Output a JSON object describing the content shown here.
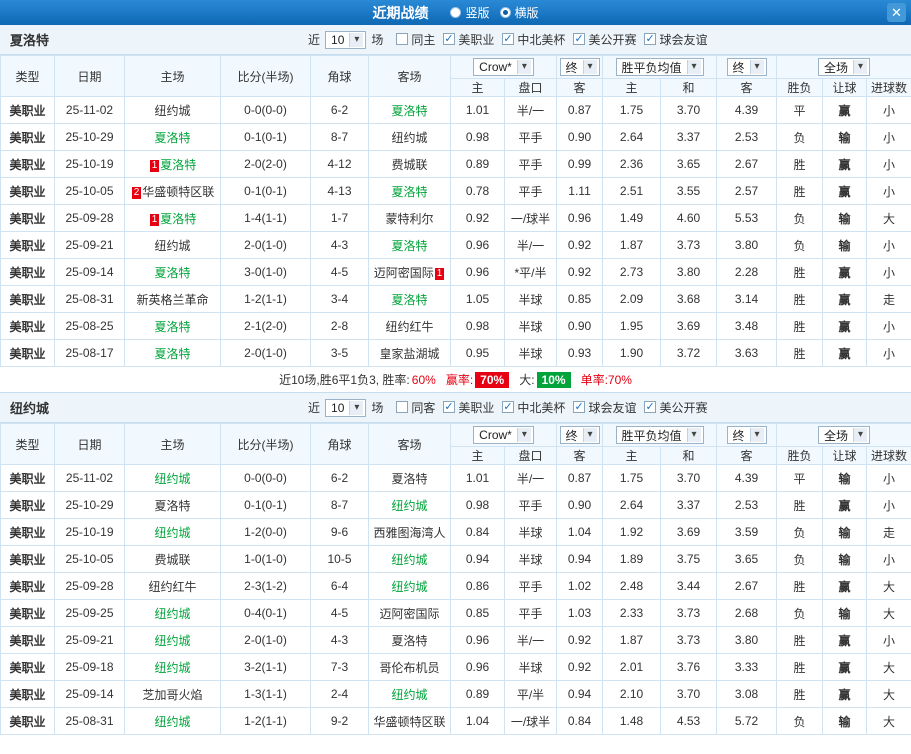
{
  "topbar": {
    "title": "近期战绩",
    "layout_options": [
      {
        "label": "竖版",
        "selected": false
      },
      {
        "label": "横版",
        "selected": true
      }
    ]
  },
  "ui": {
    "near_label": "近",
    "games_label": "场",
    "book_select": "Crow*",
    "final_select": "终",
    "avg_select": "胜平负均值",
    "scope_select": "全场",
    "columns": {
      "type": "类型",
      "date": "日期",
      "home": "主场",
      "score": "比分(半场)",
      "corners": "角球",
      "away": "客场",
      "odds_home": "主",
      "odds_line": "盘口",
      "odds_away": "客",
      "avg_home": "主",
      "avg_draw": "和",
      "avg_away": "客",
      "result": "胜负",
      "handicap": "让球",
      "goals": "进球数"
    }
  },
  "colors": {
    "accent_red": "#e60012",
    "accent_green": "#00a43a",
    "accent_blue": "#2b5ea7",
    "type_bg": "#9e0050",
    "topbar_bg": "#1478c8"
  },
  "sections": [
    {
      "team": "夏洛特",
      "recent_count": "10",
      "checkboxes": [
        {
          "label": "同主",
          "checked": false
        },
        {
          "label": "美职业",
          "checked": true
        },
        {
          "label": "中北美杯",
          "checked": true
        },
        {
          "label": "美公开赛",
          "checked": true
        },
        {
          "label": "球会友谊",
          "checked": true
        }
      ],
      "rows": [
        {
          "type": "美职业",
          "date": "25-11-02",
          "home": "纽约城",
          "home_badge": "",
          "home_focal": false,
          "score": "0-0(0-0)",
          "corners": "6-2",
          "away": "夏洛特",
          "away_badge": "",
          "away_focal": true,
          "odds": [
            "1.01",
            "半/一",
            "0.87"
          ],
          "avg": [
            "1.75",
            "3.70",
            "4.39"
          ],
          "result": "平",
          "handicap": "赢",
          "goals": "小"
        },
        {
          "type": "美职业",
          "date": "25-10-29",
          "home": "夏洛特",
          "home_badge": "",
          "home_focal": true,
          "score": "0-1(0-1)",
          "corners": "8-7",
          "away": "纽约城",
          "away_badge": "",
          "away_focal": false,
          "odds": [
            "0.98",
            "平手",
            "0.90"
          ],
          "avg": [
            "2.64",
            "3.37",
            "2.53"
          ],
          "result": "负",
          "handicap": "输",
          "goals": "小"
        },
        {
          "type": "美职业",
          "date": "25-10-19",
          "home": "夏洛特",
          "home_badge": "1",
          "home_focal": true,
          "score": "2-0(2-0)",
          "corners": "4-12",
          "away": "费城联",
          "away_badge": "",
          "away_focal": false,
          "odds": [
            "0.89",
            "平手",
            "0.99"
          ],
          "avg": [
            "2.36",
            "3.65",
            "2.67"
          ],
          "result": "胜",
          "handicap": "赢",
          "goals": "小"
        },
        {
          "type": "美职业",
          "date": "25-10-05",
          "home": "华盛顿特区联",
          "home_badge": "2",
          "home_focal": false,
          "score": "0-1(0-1)",
          "corners": "4-13",
          "away": "夏洛特",
          "away_badge": "",
          "away_focal": true,
          "odds": [
            "0.78",
            "平手",
            "1.11"
          ],
          "avg": [
            "2.51",
            "3.55",
            "2.57"
          ],
          "result": "胜",
          "handicap": "赢",
          "goals": "小"
        },
        {
          "type": "美职业",
          "date": "25-09-28",
          "home": "夏洛特",
          "home_badge": "1",
          "home_focal": true,
          "score": "1-4(1-1)",
          "corners": "1-7",
          "away": "蒙特利尔",
          "away_badge": "",
          "away_focal": false,
          "odds": [
            "0.92",
            "一/球半",
            "0.96"
          ],
          "avg": [
            "1.49",
            "4.60",
            "5.53"
          ],
          "result": "负",
          "handicap": "输",
          "goals": "大"
        },
        {
          "type": "美职业",
          "date": "25-09-21",
          "home": "纽约城",
          "home_badge": "",
          "home_focal": false,
          "score": "2-0(1-0)",
          "corners": "4-3",
          "away": "夏洛特",
          "away_badge": "",
          "away_focal": true,
          "odds": [
            "0.96",
            "半/一",
            "0.92"
          ],
          "avg": [
            "1.87",
            "3.73",
            "3.80"
          ],
          "result": "负",
          "handicap": "输",
          "goals": "小"
        },
        {
          "type": "美职业",
          "date": "25-09-14",
          "home": "夏洛特",
          "home_badge": "",
          "home_focal": true,
          "score": "3-0(1-0)",
          "corners": "4-5",
          "away": "迈阿密国际",
          "away_badge": "1",
          "away_focal": false,
          "odds": [
            "0.96",
            "*平/半",
            "0.92"
          ],
          "avg": [
            "2.73",
            "3.80",
            "2.28"
          ],
          "result": "胜",
          "handicap": "赢",
          "goals": "小"
        },
        {
          "type": "美职业",
          "date": "25-08-31",
          "home": "新英格兰革命",
          "home_badge": "",
          "home_focal": false,
          "score": "1-2(1-1)",
          "corners": "3-4",
          "away": "夏洛特",
          "away_badge": "",
          "away_focal": true,
          "odds": [
            "1.05",
            "半球",
            "0.85"
          ],
          "avg": [
            "2.09",
            "3.68",
            "3.14"
          ],
          "result": "胜",
          "handicap": "赢",
          "goals": "走"
        },
        {
          "type": "美职业",
          "date": "25-08-25",
          "home": "夏洛特",
          "home_badge": "",
          "home_focal": true,
          "score": "2-1(2-0)",
          "corners": "2-8",
          "away": "纽约红牛",
          "away_badge": "",
          "away_focal": false,
          "odds": [
            "0.98",
            "半球",
            "0.90"
          ],
          "avg": [
            "1.95",
            "3.69",
            "3.48"
          ],
          "result": "胜",
          "handicap": "赢",
          "goals": "小"
        },
        {
          "type": "美职业",
          "date": "25-08-17",
          "home": "夏洛特",
          "home_badge": "",
          "home_focal": true,
          "score": "2-0(1-0)",
          "corners": "3-5",
          "away": "皇家盐湖城",
          "away_badge": "",
          "away_focal": false,
          "odds": [
            "0.95",
            "半球",
            "0.93"
          ],
          "avg": [
            "1.90",
            "3.72",
            "3.63"
          ],
          "result": "胜",
          "handicap": "赢",
          "goals": "小"
        }
      ],
      "summary": {
        "prefix": "近10场,胜6平1负3, 胜率:",
        "win_pct": "60%",
        "handicap_label": "赢率:",
        "handicap_pct": "70%",
        "big_label": "大:",
        "big_pct": "10%",
        "single_label": "单率:70%"
      }
    },
    {
      "team": "纽约城",
      "recent_count": "10",
      "checkboxes": [
        {
          "label": "同客",
          "checked": false
        },
        {
          "label": "美职业",
          "checked": true
        },
        {
          "label": "中北美杯",
          "checked": true
        },
        {
          "label": "球会友谊",
          "checked": true
        },
        {
          "label": "美公开赛",
          "checked": true
        }
      ],
      "rows": [
        {
          "type": "美职业",
          "date": "25-11-02",
          "home": "纽约城",
          "home_badge": "",
          "home_focal": true,
          "score": "0-0(0-0)",
          "corners": "6-2",
          "away": "夏洛特",
          "away_badge": "",
          "away_focal": false,
          "odds": [
            "1.01",
            "半/一",
            "0.87"
          ],
          "avg": [
            "1.75",
            "3.70",
            "4.39"
          ],
          "result": "平",
          "handicap": "输",
          "goals": "小"
        },
        {
          "type": "美职业",
          "date": "25-10-29",
          "home": "夏洛特",
          "home_badge": "",
          "home_focal": false,
          "score": "0-1(0-1)",
          "corners": "8-7",
          "away": "纽约城",
          "away_badge": "",
          "away_focal": true,
          "odds": [
            "0.98",
            "平手",
            "0.90"
          ],
          "avg": [
            "2.64",
            "3.37",
            "2.53"
          ],
          "result": "胜",
          "handicap": "赢",
          "goals": "小"
        },
        {
          "type": "美职业",
          "date": "25-10-19",
          "home": "纽约城",
          "home_badge": "",
          "home_focal": true,
          "score": "1-2(0-0)",
          "corners": "9-6",
          "away": "西雅图海湾人",
          "away_badge": "",
          "away_focal": false,
          "odds": [
            "0.84",
            "半球",
            "1.04"
          ],
          "avg": [
            "1.92",
            "3.69",
            "3.59"
          ],
          "result": "负",
          "handicap": "输",
          "goals": "走"
        },
        {
          "type": "美职业",
          "date": "25-10-05",
          "home": "费城联",
          "home_badge": "",
          "home_focal": false,
          "score": "1-0(1-0)",
          "corners": "10-5",
          "away": "纽约城",
          "away_badge": "",
          "away_focal": true,
          "odds": [
            "0.94",
            "半球",
            "0.94"
          ],
          "avg": [
            "1.89",
            "3.75",
            "3.65"
          ],
          "result": "负",
          "handicap": "输",
          "goals": "小"
        },
        {
          "type": "美职业",
          "date": "25-09-28",
          "home": "纽约红牛",
          "home_badge": "",
          "home_focal": false,
          "score": "2-3(1-2)",
          "corners": "6-4",
          "away": "纽约城",
          "away_badge": "",
          "away_focal": true,
          "odds": [
            "0.86",
            "平手",
            "1.02"
          ],
          "avg": [
            "2.48",
            "3.44",
            "2.67"
          ],
          "result": "胜",
          "handicap": "赢",
          "goals": "大"
        },
        {
          "type": "美职业",
          "date": "25-09-25",
          "home": "纽约城",
          "home_badge": "",
          "home_focal": true,
          "score": "0-4(0-1)",
          "corners": "4-5",
          "away": "迈阿密国际",
          "away_badge": "",
          "away_focal": false,
          "odds": [
            "0.85",
            "平手",
            "1.03"
          ],
          "avg": [
            "2.33",
            "3.73",
            "2.68"
          ],
          "result": "负",
          "handicap": "输",
          "goals": "大"
        },
        {
          "type": "美职业",
          "date": "25-09-21",
          "home": "纽约城",
          "home_badge": "",
          "home_focal": true,
          "score": "2-0(1-0)",
          "corners": "4-3",
          "away": "夏洛特",
          "away_badge": "",
          "away_focal": false,
          "odds": [
            "0.96",
            "半/一",
            "0.92"
          ],
          "avg": [
            "1.87",
            "3.73",
            "3.80"
          ],
          "result": "胜",
          "handicap": "赢",
          "goals": "小"
        },
        {
          "type": "美职业",
          "date": "25-09-18",
          "home": "纽约城",
          "home_badge": "",
          "home_focal": true,
          "score": "3-2(1-1)",
          "corners": "7-3",
          "away": "哥伦布机员",
          "away_badge": "",
          "away_focal": false,
          "odds": [
            "0.96",
            "半球",
            "0.92"
          ],
          "avg": [
            "2.01",
            "3.76",
            "3.33"
          ],
          "result": "胜",
          "handicap": "赢",
          "goals": "大"
        },
        {
          "type": "美职业",
          "date": "25-09-14",
          "home": "芝加哥火焰",
          "home_badge": "",
          "home_focal": false,
          "score": "1-3(1-1)",
          "corners": "2-4",
          "away": "纽约城",
          "away_badge": "",
          "away_focal": true,
          "odds": [
            "0.89",
            "平/半",
            "0.94"
          ],
          "avg": [
            "2.10",
            "3.70",
            "3.08"
          ],
          "result": "胜",
          "handicap": "赢",
          "goals": "大"
        },
        {
          "type": "美职业",
          "date": "25-08-31",
          "home": "纽约城",
          "home_badge": "",
          "home_focal": true,
          "score": "1-2(1-1)",
          "corners": "9-2",
          "away": "华盛顿特区联",
          "away_badge": "",
          "away_focal": false,
          "odds": [
            "1.04",
            "一/球半",
            "0.84"
          ],
          "avg": [
            "1.48",
            "4.53",
            "5.72"
          ],
          "result": "负",
          "handicap": "输",
          "goals": "大"
        }
      ]
    }
  ]
}
